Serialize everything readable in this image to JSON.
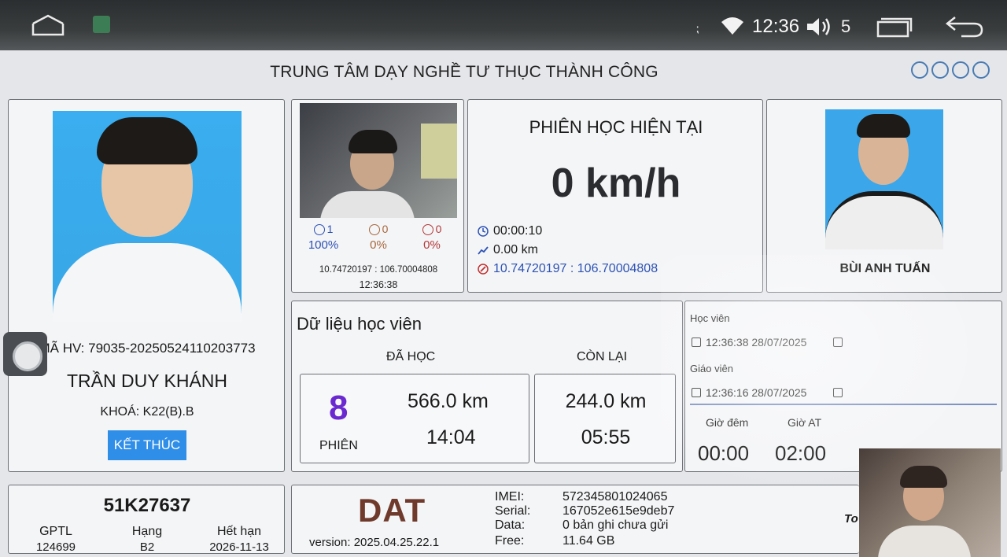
{
  "statusbar": {
    "time": "12:36",
    "volume": "5",
    "icons": [
      "home-icon",
      "app-icon",
      "wifi-icon",
      "volume-icon",
      "recents-icon",
      "back-icon"
    ]
  },
  "header": {
    "title": "TRUNG TÂM DẠY NGHỀ TƯ THỤC THÀNH CÔNG",
    "icons": [
      "gps-icon",
      "globe-icon",
      "camera-icon",
      "database-icon"
    ]
  },
  "student": {
    "id_line": "MÃ HV: 79035-20250524110203773",
    "name": "TRẦN DUY KHÁNH",
    "course": "KHOÁ: K22(B).B",
    "end_button": "KẾT THÚC"
  },
  "camera": {
    "stats": [
      {
        "count": "1",
        "percent": "100%"
      },
      {
        "count": "0",
        "percent": "0%"
      },
      {
        "count": "0",
        "percent": "0%"
      }
    ],
    "coords": "10.74720197 : 106.70004808",
    "time": "12:36:38"
  },
  "session": {
    "title": "PHIÊN HỌC HIỆN TẠI",
    "speed": "0 km/h",
    "duration": "00:00:10",
    "distance": "0.00 km",
    "coords": "10.74720197 : 106.70004808"
  },
  "teacher": {
    "name": "BÙI ANH TUẤN"
  },
  "student_data": {
    "title": "Dữ liệu học viên",
    "done_header": "ĐÃ HỌC",
    "remaining_header": "CÒN LẠI",
    "sessions": "8",
    "sessions_label": "PHIÊN",
    "done_km": "566.0 km",
    "done_time": "14:04",
    "remaining_km": "244.0 km",
    "remaining_time": "05:55"
  },
  "login": {
    "student_label": "Học viên",
    "student_time": "12:36:38 28/07/2025",
    "teacher_label": "Giáo viên",
    "teacher_time": "12:36:16 28/07/2025",
    "night_label": "Giờ đêm",
    "at_label": "Giờ AT",
    "night_value": "00:00",
    "at_value": "02:00"
  },
  "vehicle": {
    "plate": "51K27637",
    "gptl_label": "GPTL",
    "gptl_value": "124699",
    "class_label": "Hạng",
    "class_value": "B2",
    "expiry_label": "Hết hạn",
    "expiry_value": "2026-11-13"
  },
  "device": {
    "logo": "DAT",
    "version": "version: 2025.04.25.22.1",
    "imei_label": "IMEI:",
    "imei_value": "572345801024065",
    "serial_label": "Serial:",
    "serial_value": "167052e615e9deb7",
    "data_label": "Data:",
    "data_value": "0 bản ghi chưa gửi",
    "free_label": "Free:",
    "free_value": "11.64 GB",
    "cut_label": "To"
  },
  "colors": {
    "accent_blue": "#2f8ee8",
    "photo_bg": "#3aaef0",
    "session_count": "#6b2ad0",
    "coords_blue": "#2d52b5"
  }
}
